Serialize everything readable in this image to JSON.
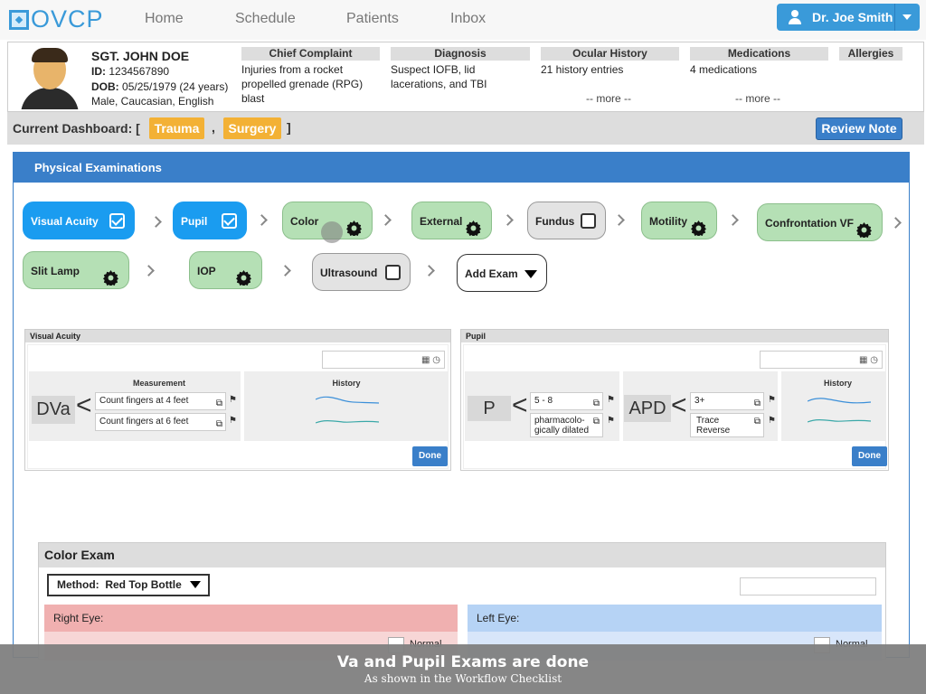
{
  "app": {
    "logo": "OVCP"
  },
  "nav": {
    "links": [
      "Home",
      "Schedule",
      "Patients",
      "Inbox"
    ],
    "user": "Dr. Joe Smith"
  },
  "patient": {
    "name": "SGT. JOHN DOE",
    "id_label": "ID:",
    "id": "1234567890",
    "dob_label": "DOB:",
    "dob": "05/25/1979 (24 years)",
    "demo": "Male, Caucasian, English",
    "columns": [
      {
        "title": "Chief Complaint",
        "body": "Injuries from a rocket propelled grenade (RPG) blast",
        "more": ""
      },
      {
        "title": "Diagnosis",
        "body": "Suspect IOFB, lid lacerations, and TBI",
        "more": ""
      },
      {
        "title": "Ocular History",
        "body": "21 history entries",
        "more": "-- more --"
      },
      {
        "title": "Medications",
        "body": "4 medications",
        "more": "-- more --"
      },
      {
        "title": "Allergies",
        "body": "",
        "more": ""
      }
    ]
  },
  "dashboard": {
    "label": "Current Dashboard: [",
    "tags": [
      "Trauma",
      "Surgery"
    ],
    "separator": ",",
    "close": "]",
    "review_button": "Review Note"
  },
  "physical_exam": {
    "title": "Physical Examinations",
    "steps": [
      {
        "label": "Visual Acuity",
        "state": "done"
      },
      {
        "label": "Pupil",
        "state": "done"
      },
      {
        "label": "Color",
        "state": "active"
      },
      {
        "label": "External",
        "state": "active"
      },
      {
        "label": "Fundus",
        "state": "pending"
      },
      {
        "label": "Motility",
        "state": "active"
      },
      {
        "label": "Confrontation VF",
        "state": "active"
      },
      {
        "label": "Slit Lamp",
        "state": "active"
      },
      {
        "label": "IOP",
        "state": "active"
      },
      {
        "label": "Ultrasound",
        "state": "pending"
      },
      {
        "label": "Add Exam",
        "state": "add"
      }
    ]
  },
  "va_card": {
    "title": "Visual Acuity",
    "label": "DVa",
    "measurement_title": "Measurement",
    "history_title": "History",
    "values": [
      "Count fingers at 4 feet",
      "Count fingers at 6 feet"
    ],
    "done": "Done"
  },
  "pupil_card": {
    "title": "Pupil",
    "p_label": "P",
    "p_values": [
      "5 - 8",
      "pharmacolo-gically dilated"
    ],
    "apd_label": "APD",
    "apd_values": [
      "3+",
      "Trace Reverse"
    ],
    "history_title": "History",
    "done": "Done"
  },
  "color_exam": {
    "title": "Color Exam",
    "method_label": "Method:",
    "method_value": "Red Top Bottle",
    "right_eye": "Right Eye:",
    "left_eye": "Left Eye:",
    "normal_label": "Normal"
  },
  "caption": {
    "main": "Va and Pupil Exams are done",
    "sub": "As shown in the Workflow Checklist"
  },
  "colors": {
    "brand_blue": "#3a9ad9",
    "header_blue": "#3a7fc9",
    "done_blue": "#1a9cf0",
    "active_green": "#b5e0b5",
    "tag_orange": "#f3b135"
  }
}
